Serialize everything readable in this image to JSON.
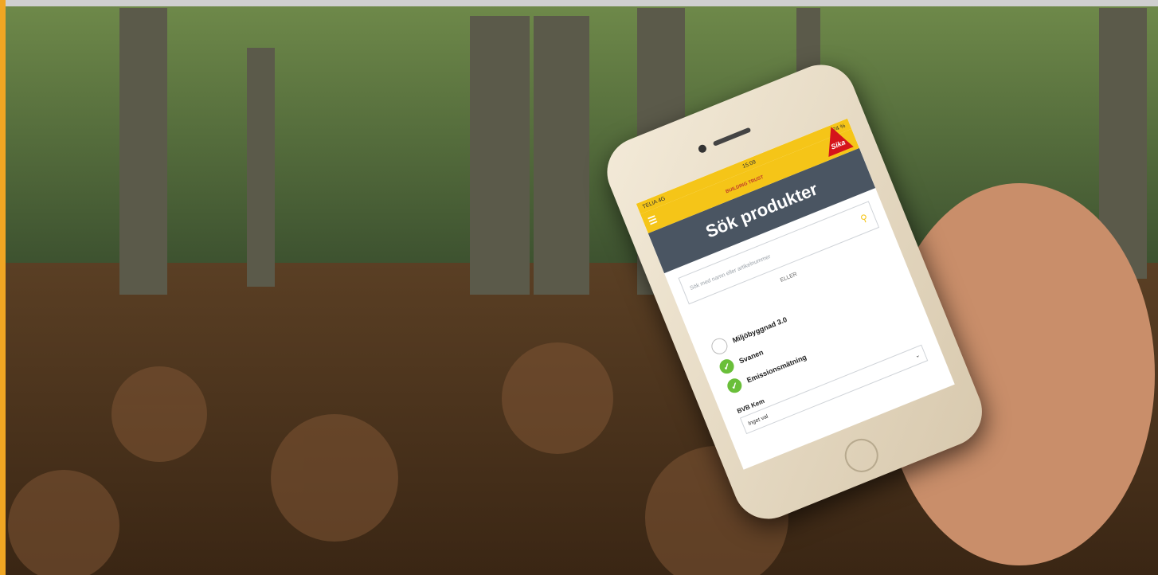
{
  "app": {
    "status": {
      "carrier": "TELIA 4G",
      "time": "15:09",
      "battery": "74 %"
    },
    "brand": {
      "tagline": "BUILDING TRUST",
      "logo": "Sika"
    },
    "menu_icon": "hamburger-icon",
    "title": "Sök produkter",
    "search": {
      "placeholder": "Sök med namn eller artikelnummer",
      "icon": "search-icon"
    },
    "divider": "ELLER",
    "options": [
      {
        "label": "Miljöbyggnad 3.0",
        "checked": false
      },
      {
        "label": "Svanen",
        "checked": true
      },
      {
        "label": "Emissionsmätning",
        "checked": true
      }
    ],
    "bvb": {
      "label": "BVB Kem",
      "value": "Inget val"
    }
  },
  "colors": {
    "accent": "#f5c518",
    "header": "#4a5562",
    "check": "#6abf3a",
    "brand_red": "#d5141b",
    "left_stripe": "#f0a623"
  }
}
